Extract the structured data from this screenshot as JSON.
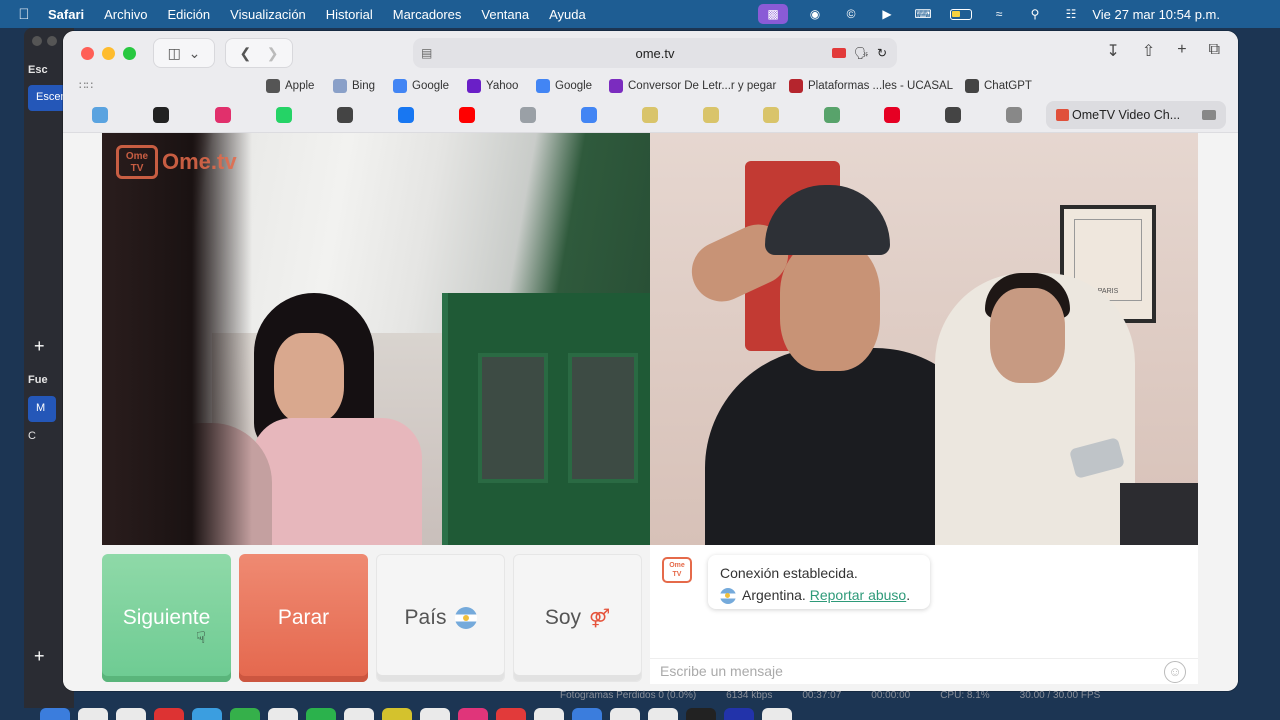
{
  "menubar": {
    "app": "Safari",
    "items": [
      "Archivo",
      "Edición",
      "Visualización",
      "Historial",
      "Marcadores",
      "Ventana",
      "Ayuda"
    ],
    "clock": "Vie 27 mar 10:54 p.m."
  },
  "obs": {
    "scenes_title": "Esc",
    "scene_selected": "Escen",
    "sources_title": "Fue",
    "source_1": "M",
    "source_2": "C"
  },
  "browser": {
    "url": "ome.tv",
    "favorites": [
      {
        "label": "Apple",
        "color": "#555555"
      },
      {
        "label": "Bing",
        "color": "#8aa0c8"
      },
      {
        "label": "Google",
        "color": "#4285f4"
      },
      {
        "label": "Yahoo",
        "color": "#6a1fc7"
      },
      {
        "label": "Google",
        "color": "#4285f4"
      },
      {
        "label": "Conversor De Letr...r y pegar",
        "color": "#7b2cbf"
      },
      {
        "label": "Plataformas ...les - UCASAL",
        "color": "#b5252d"
      },
      {
        "label": "ChatGPT",
        "color": "#444444"
      }
    ],
    "tab_icon_colors": [
      "#5aa3e0",
      "#222222",
      "#e1306c",
      "#25d366",
      "#444444",
      "#1877f2",
      "#ff0000",
      "#9aa0a6",
      "#4285f4",
      "#d9c46a",
      "#d9c46a",
      "#d9c46a",
      "#58a36b",
      "#e60023",
      "#444444",
      "#888888"
    ],
    "active_tab": "OmeTV Video Ch..."
  },
  "omegle": {
    "logo_box": "Ome TV",
    "logo_text": "Ome.tv",
    "buttons": {
      "next": "Siguiente",
      "stop": "Parar",
      "country": "País",
      "gender": "Soy"
    },
    "chat": {
      "line1": "Conexión establecida.",
      "country": "Argentina.",
      "report": "Reportar abuso",
      "report_end": ".",
      "placeholder": "Escribe un mensaje"
    },
    "map_label": "PARIS"
  },
  "obs_status": {
    "dropped": "Fotogramas Perdidos 0 (0.0%)",
    "bitrate": "6134 kbps",
    "time1": "00:37:07",
    "time2": "00:00:00",
    "cpu": "CPU: 8.1%",
    "fps": "30.00 / 30.00 FPS"
  },
  "colors": {
    "menubar": "#1e5d93",
    "next_button": "#6dcb92",
    "stop_button": "#e4674d",
    "brand": "#e56a4a",
    "link": "#2e9a79"
  },
  "dock_colors": [
    "#3b7ddd",
    "#eaeaea",
    "#eaeaea",
    "#d33",
    "#3b9ee0",
    "#35b04a",
    "#eaeaea",
    "#2bb24c",
    "#eaeaea",
    "#d4c22d",
    "#eaeaea",
    "#e0357a",
    "#e23a3a",
    "#eaeaea",
    "#3b7ddd",
    "#eaeaea",
    "#eaeaea",
    "#222",
    "#2233aa",
    "#eaeaea"
  ]
}
